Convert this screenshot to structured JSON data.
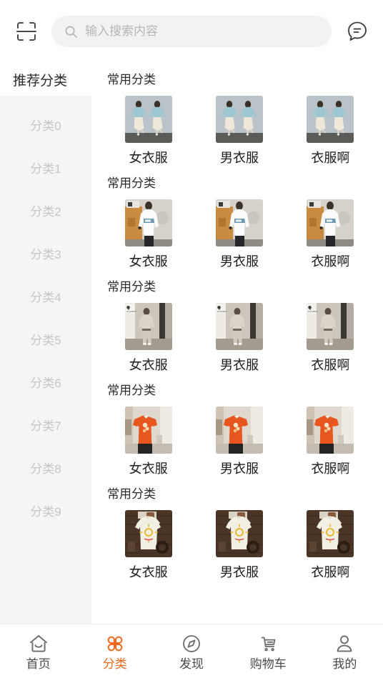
{
  "header": {
    "scan_icon": "scan-icon",
    "search": {
      "icon": "search-icon",
      "placeholder": "输入搜索内容",
      "value": ""
    },
    "message_icon": "message-icon"
  },
  "sidebar": {
    "title": "推荐分类",
    "items": [
      {
        "label": "分类0"
      },
      {
        "label": "分类1"
      },
      {
        "label": "分类2"
      },
      {
        "label": "分类3"
      },
      {
        "label": "分类4"
      },
      {
        "label": "分类5"
      },
      {
        "label": "分类6"
      },
      {
        "label": "分类7"
      },
      {
        "label": "分类8"
      },
      {
        "label": "分类9"
      }
    ]
  },
  "main": {
    "sections": [
      {
        "title": "常用分类",
        "theme": "bluewoman",
        "items": [
          {
            "label": "女衣服"
          },
          {
            "label": "男衣服"
          },
          {
            "label": "衣服啊"
          }
        ]
      },
      {
        "title": "常用分类",
        "theme": "whitesweater",
        "items": [
          {
            "label": "女衣服"
          },
          {
            "label": "男衣服"
          },
          {
            "label": "衣服啊"
          }
        ]
      },
      {
        "title": "常用分类",
        "theme": "graysuit",
        "items": [
          {
            "label": "女衣服"
          },
          {
            "label": "男衣服"
          },
          {
            "label": "衣服啊"
          }
        ]
      },
      {
        "title": "常用分类",
        "theme": "orangetee",
        "items": [
          {
            "label": "女衣服"
          },
          {
            "label": "男衣服"
          },
          {
            "label": "衣服啊"
          }
        ]
      },
      {
        "title": "常用分类",
        "theme": "creamtee",
        "items": [
          {
            "label": "女衣服"
          },
          {
            "label": "男衣服"
          },
          {
            "label": "衣服啊"
          }
        ]
      }
    ]
  },
  "tabbar": {
    "active_color": "#f2681b",
    "inactive_color": "#4a4a4a",
    "tabs": [
      {
        "label": "首页",
        "icon": "home-icon",
        "active": false
      },
      {
        "label": "分类",
        "icon": "category-clover-icon",
        "active": true
      },
      {
        "label": "发现",
        "icon": "compass-icon",
        "active": false
      },
      {
        "label": "购物车",
        "icon": "shopping-cart-icon",
        "active": false
      },
      {
        "label": "我的",
        "icon": "person-icon",
        "active": false
      }
    ]
  }
}
